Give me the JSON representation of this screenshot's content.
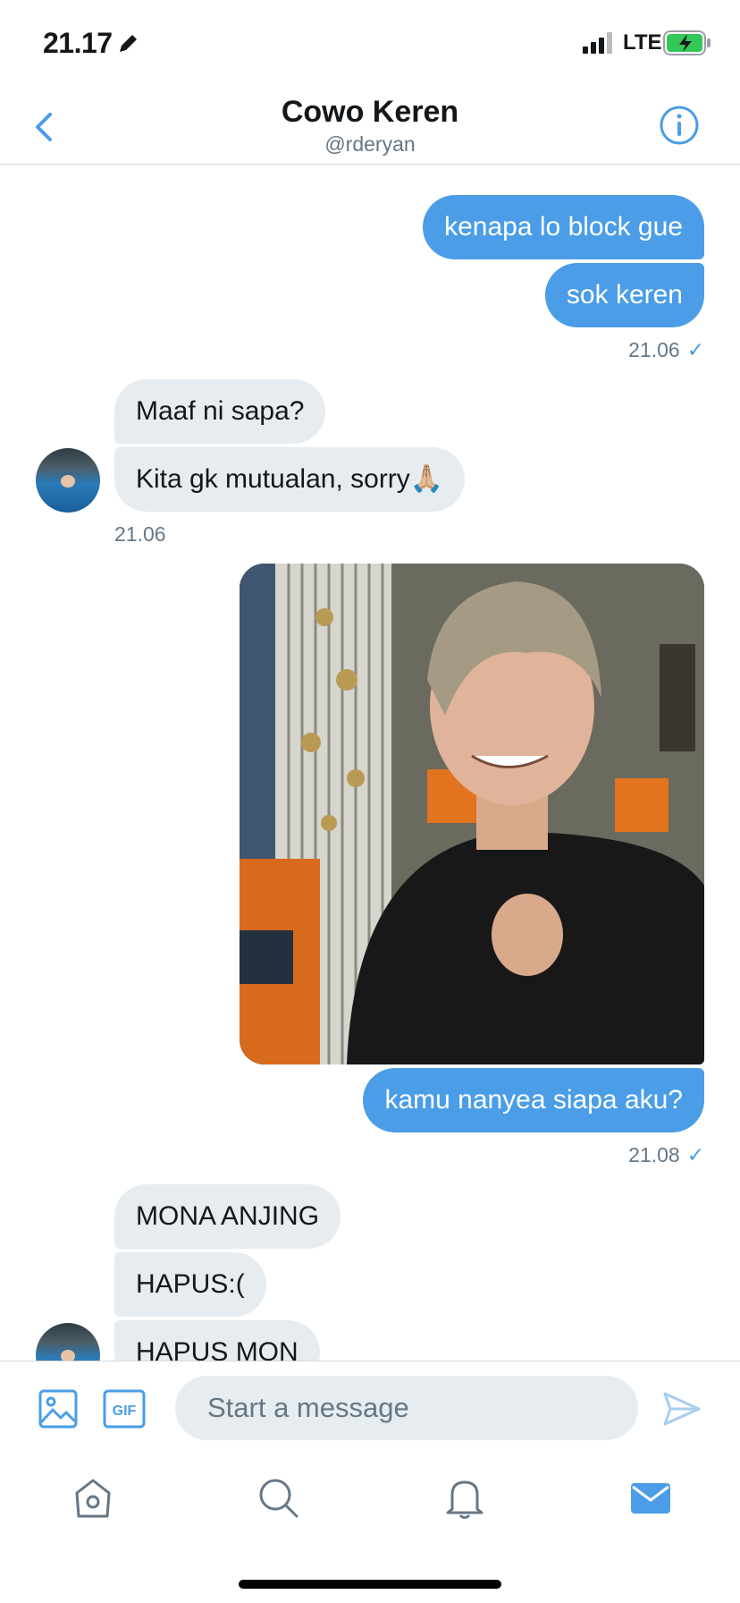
{
  "status_bar": {
    "time": "21.17",
    "network": "LTE"
  },
  "header": {
    "title": "Cowo Keren",
    "handle": "@rderyan"
  },
  "messages": [
    {
      "id": "m1",
      "dir": "sent",
      "text": "kenapa lo block gue"
    },
    {
      "id": "m2",
      "dir": "sent",
      "text": "sok keren"
    },
    {
      "id": "t1",
      "time": "21.06",
      "check": "✓"
    },
    {
      "id": "m3",
      "dir": "received",
      "text": "Maaf ni sapa?"
    },
    {
      "id": "m4",
      "dir": "received",
      "text": "Kita gk mutualan, sorry🙏🏼"
    },
    {
      "id": "t2",
      "time": "21.06"
    },
    {
      "id": "img",
      "dir": "sent",
      "type": "image"
    },
    {
      "id": "m5",
      "dir": "sent",
      "text": "kamu nanyea siapa aku?"
    },
    {
      "id": "t3",
      "time": "21.08",
      "check": "✓"
    },
    {
      "id": "m6",
      "dir": "received",
      "text": "MONA ANJING"
    },
    {
      "id": "m7",
      "dir": "received",
      "text": "HAPUS:("
    },
    {
      "id": "m8",
      "dir": "received",
      "text": "HAPUS MON"
    }
  ],
  "composer": {
    "placeholder": "Start a message",
    "gif_label": "GIF"
  },
  "tabs": [
    "home-icon",
    "search-icon",
    "bell-icon",
    "mail-icon"
  ],
  "colors": {
    "accent": "#4a9de6",
    "received_bubble": "#e6ecf0",
    "secondary_text": "#657786"
  }
}
